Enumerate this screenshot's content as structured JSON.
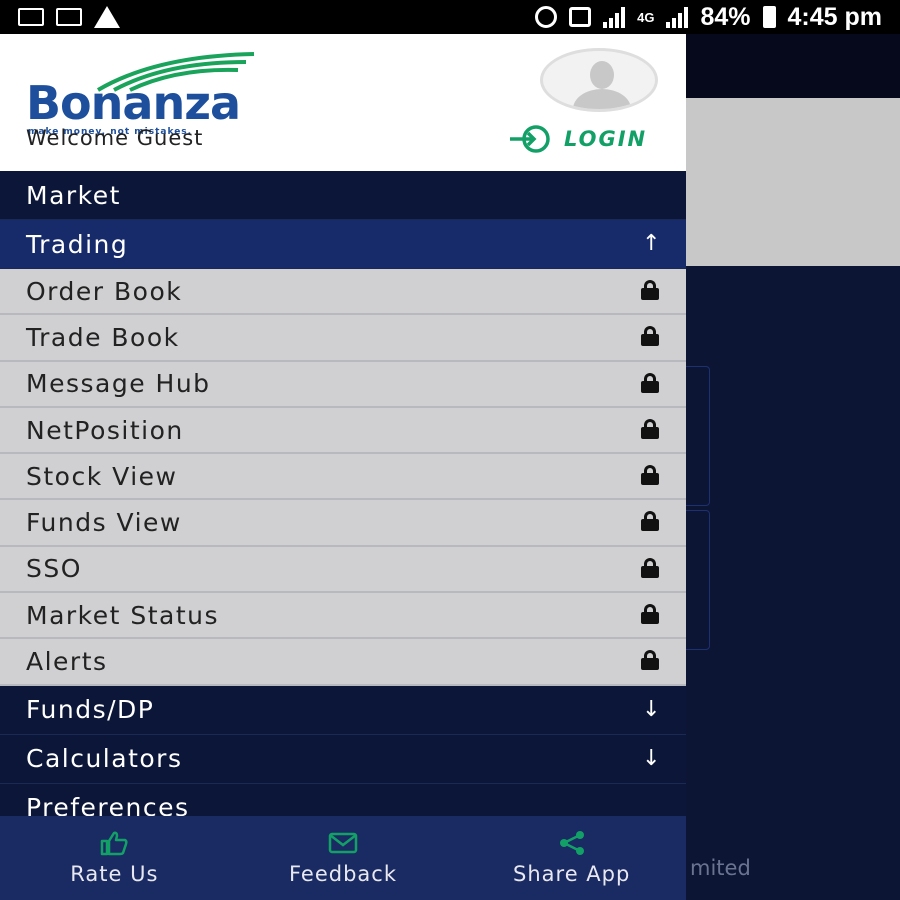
{
  "status_bar": {
    "battery": "84%",
    "time": "4:45 pm",
    "network": "4G"
  },
  "header": {
    "logo_text": "Bonanza",
    "logo_tagline": "make money, not mistakes.",
    "welcome": "Welcome Guest",
    "login_label": "LOGIN"
  },
  "menu": {
    "market": "Market",
    "trading": "Trading",
    "trading_items": [
      "Order Book",
      "Trade Book",
      "Message Hub",
      "NetPosition",
      "Stock View",
      "Funds View",
      "SSO",
      "Market Status",
      "Alerts"
    ],
    "funds_dp": "Funds/DP",
    "calculators": "Calculators",
    "preferences": "Preferences"
  },
  "bottom_bar": {
    "rate_us": "Rate Us",
    "feedback": "Feedback",
    "share_app": "Share App"
  },
  "background": {
    "footer_text": "mited"
  },
  "colors": {
    "brand_blue": "#1d4f9c",
    "login_green": "#13a067",
    "drawer_navy": "#0b1638",
    "trading_highlight": "#172a6a",
    "submenu_gray": "#d0d0d3"
  }
}
